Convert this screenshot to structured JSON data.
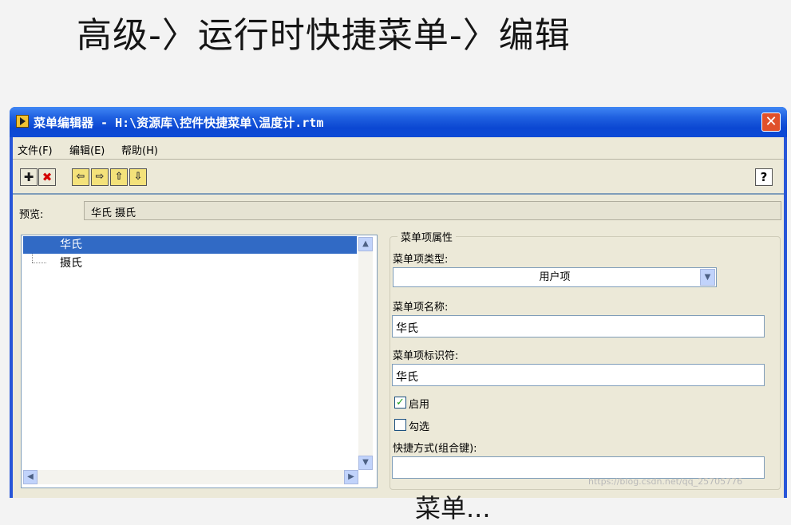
{
  "slide": {
    "title": "高级-〉运行时快捷菜单-〉编辑",
    "bottom_text": "菜单...",
    "watermark": "https://blog.csdn.net/qq_25705776"
  },
  "window": {
    "title": "菜单编辑器 - H:\\资源库\\控件快捷菜单\\温度计.rtm",
    "close_glyph": "✕"
  },
  "menubar": {
    "items": [
      "文件(F)",
      "编辑(E)",
      "帮助(H)"
    ]
  },
  "toolbar": {
    "add_glyph": "✚",
    "delete_glyph": "✖",
    "left_glyph": "⇦",
    "right_glyph": "⇨",
    "up_glyph": "⇧",
    "down_glyph": "⇩",
    "help_glyph": "?"
  },
  "preview": {
    "label": "预览:",
    "value": "华氏   摄氏"
  },
  "tree": {
    "items": [
      "华氏",
      "摄氏"
    ],
    "selected_index": 0,
    "scroll_up": "▲",
    "scroll_down": "▼",
    "scroll_left": "◀",
    "scroll_right": "▶"
  },
  "properties": {
    "group_title": "菜单项属性",
    "type_label": "菜单项类型:",
    "type_value": "用户项",
    "dropdown_glyph": "▼",
    "name_label": "菜单项名称:",
    "name_value": "华氏",
    "tag_label": "菜单项标识符:",
    "tag_value": "华氏",
    "enabled_label": "启用",
    "enabled_checked": true,
    "check_glyph": "✓",
    "checked_label": "勾选",
    "checked_checked": false,
    "shortcut_label": "快捷方式(组合键):",
    "shortcut_value": ""
  },
  "colors": {
    "titlebar": "#0b47d2",
    "selection": "#316ac5",
    "window_bg": "#ece9d8",
    "close": "#e0502a"
  }
}
